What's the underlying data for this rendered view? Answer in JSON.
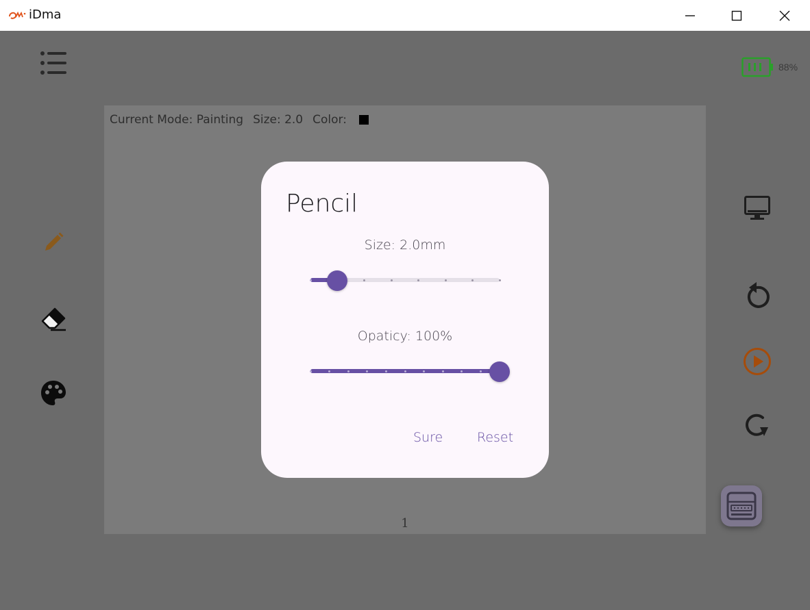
{
  "window": {
    "title": "iDma",
    "logo_text": "iDma"
  },
  "battery": {
    "percent_label": "88%",
    "level": 0.88,
    "color": "#2aa02a"
  },
  "icons": {
    "menu": "list-menu-icon",
    "pencil": "pencil-icon",
    "eraser": "eraser-icon",
    "palette": "palette-icon",
    "monitor": "monitor-icon",
    "undo": "undo-icon",
    "play": "play-icon",
    "redo": "redo-icon",
    "keyboard": "keyboard-icon"
  },
  "colors": {
    "pencil_icon": "#8a5a1c",
    "play_icon": "#a64c0a",
    "accent": "#6750a4",
    "dialog_bg": "#fdf7fd"
  },
  "canvas": {
    "mode_text": "Current Mode: Painting",
    "size_text": "Size: 2.0",
    "color_label": "Color:",
    "current_color": "#000000",
    "page_number": "1"
  },
  "dialog": {
    "title": "Pencil",
    "size_label": "Size: 2.0mm",
    "size_fraction": 0.14,
    "opacity_label": "Opaticy: 100%",
    "opacity_fraction": 1.0,
    "sure_label": "Sure",
    "reset_label": "Reset"
  }
}
